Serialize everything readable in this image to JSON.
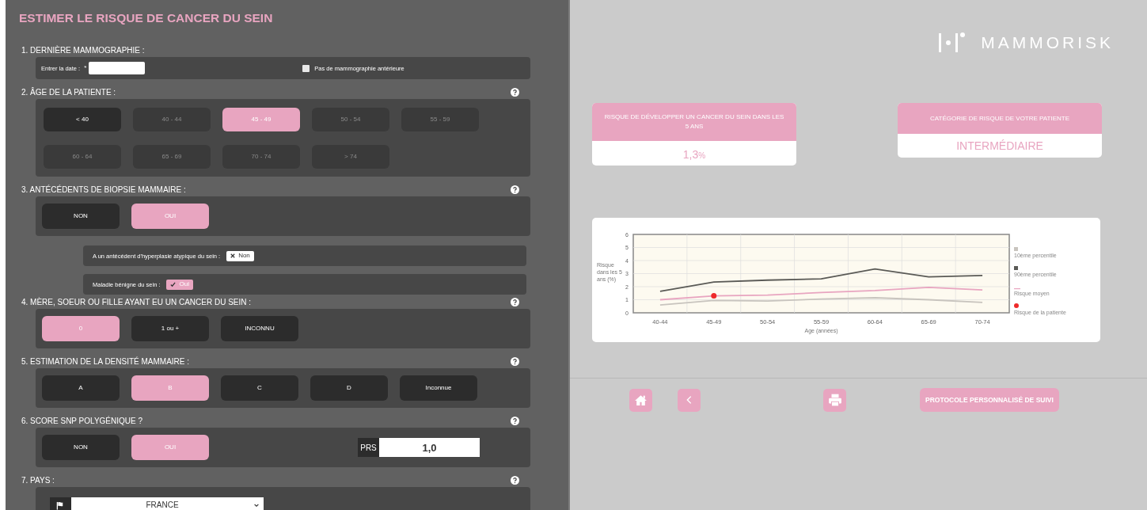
{
  "form": {
    "title": "ESTIMER LE RISQUE DE CANCER DU SEIN",
    "sections": [
      {
        "kind": "date",
        "label": "1. DERNIÈRE MAMMOGRAPHIE :",
        "help": false,
        "date_label": "Entrer la date :",
        "required_mark": "*",
        "checkbox": {
          "label": "Pas de mammographie antérieure",
          "checked": false
        }
      },
      {
        "kind": "options",
        "label": "2. ÂGE DE LA PATIENTE :",
        "help": true,
        "options": [
          {
            "label": "< 40",
            "selected": false,
            "disabled": false
          },
          {
            "label": "40 - 44",
            "selected": false,
            "disabled": true
          },
          {
            "label": "45 - 49",
            "selected": true,
            "disabled": false
          },
          {
            "label": "50 - 54",
            "selected": false,
            "disabled": true
          },
          {
            "label": "55 - 59",
            "selected": false,
            "disabled": true
          },
          {
            "label": "60 - 64",
            "selected": false,
            "disabled": true
          },
          {
            "label": "65 - 69",
            "selected": false,
            "disabled": true
          },
          {
            "label": "70 - 74",
            "selected": false,
            "disabled": true
          },
          {
            "label": "> 74",
            "selected": false,
            "disabled": true
          }
        ]
      },
      {
        "kind": "options",
        "label": "3. ANTÉCÉDENTS DE BIOPSIE MAMMAIRE :",
        "help": true,
        "options": [
          {
            "label": "NON",
            "selected": false,
            "disabled": false
          },
          {
            "label": "OUI",
            "selected": true,
            "disabled": false
          }
        ],
        "sub_rows": [
          {
            "label": "A un antécédent d'hyperplasie atypique du sein :",
            "toggle": {
              "text": "Non",
              "on": false
            }
          },
          {
            "label": "Maladie bénigne du sein :",
            "toggle": {
              "text": "Oui",
              "on": true
            }
          }
        ]
      },
      {
        "kind": "options",
        "label": "4. MÈRE, SOEUR OU FILLE AYANT EU UN CANCER DU SEIN :",
        "help": true,
        "options": [
          {
            "label": "0",
            "selected": true,
            "disabled": false
          },
          {
            "label": "1 ou +",
            "selected": false,
            "disabled": false
          },
          {
            "label": "INCONNU",
            "selected": false,
            "disabled": false
          }
        ]
      },
      {
        "kind": "options",
        "label": "5. ESTIMATION DE LA DENSITÉ MAMMAIRE :",
        "help": true,
        "options": [
          {
            "label": "A",
            "selected": false,
            "disabled": false
          },
          {
            "label": "B",
            "selected": true,
            "disabled": false
          },
          {
            "label": "C",
            "selected": false,
            "disabled": false
          },
          {
            "label": "D",
            "selected": false,
            "disabled": false
          },
          {
            "label": "Inconnue",
            "selected": false,
            "disabled": false
          }
        ]
      },
      {
        "kind": "options",
        "label": "6. SCORE SNP POLYGÉNIQUE ?",
        "help": true,
        "options": [
          {
            "label": "NON",
            "selected": false,
            "disabled": false
          },
          {
            "label": "OUI",
            "selected": true,
            "disabled": false
          }
        ],
        "prs": {
          "label": "PRS",
          "value": "1,0"
        }
      },
      {
        "kind": "select",
        "label": "7. PAYS :",
        "help": true,
        "value": "FRANCE"
      }
    ]
  },
  "results": {
    "logo": "MAMMORISK",
    "cards": [
      {
        "title": "RISQUE DE DÉVELOPPER UN CANCER DU SEIN DANS LES 5 ANS",
        "value": "1,3",
        "unit": "%"
      },
      {
        "title": "CATÉGORIE DE RISQUE DE VOTRE PATIENTE",
        "value": "INTERMÉDIAIRE"
      }
    ],
    "chart_data": {
      "type": "line",
      "xlabel": "Age (années)",
      "ylabel": "Risque dans les 5 ans (%)",
      "grid": true,
      "legend": true,
      "categories": [
        "40-44",
        "45-49",
        "50-54",
        "55-59",
        "60-64",
        "65-69",
        "70-74"
      ],
      "ylim": [
        0,
        6
      ],
      "yticks": [
        0,
        1,
        2,
        3,
        4,
        5,
        6
      ],
      "series": [
        {
          "name": "10ème percentile",
          "color": "#c8c4be",
          "values": [
            0.6,
            0.95,
            0.9,
            1.05,
            1.15,
            1.0,
            0.8
          ]
        },
        {
          "name": "90ème percentile",
          "color": "#5a5a56",
          "values": [
            1.65,
            2.35,
            2.5,
            2.6,
            3.35,
            2.75,
            2.85
          ]
        },
        {
          "name": "Risque moyen",
          "color": "#e8a5c0",
          "values": [
            1.0,
            1.3,
            1.35,
            1.55,
            1.7,
            1.95,
            1.75
          ]
        },
        {
          "name": "Risque de la patiente",
          "color": "#ee2a2a",
          "marker": "circle",
          "values": [
            null,
            1.3,
            null,
            null,
            null,
            null,
            null
          ]
        }
      ]
    },
    "actions": [
      {
        "kind": "home"
      },
      {
        "kind": "back"
      },
      {
        "kind": "print"
      },
      {
        "kind": "text",
        "label": "PROTOCOLE PERSONNALISÉ DE SUIVI"
      }
    ]
  }
}
